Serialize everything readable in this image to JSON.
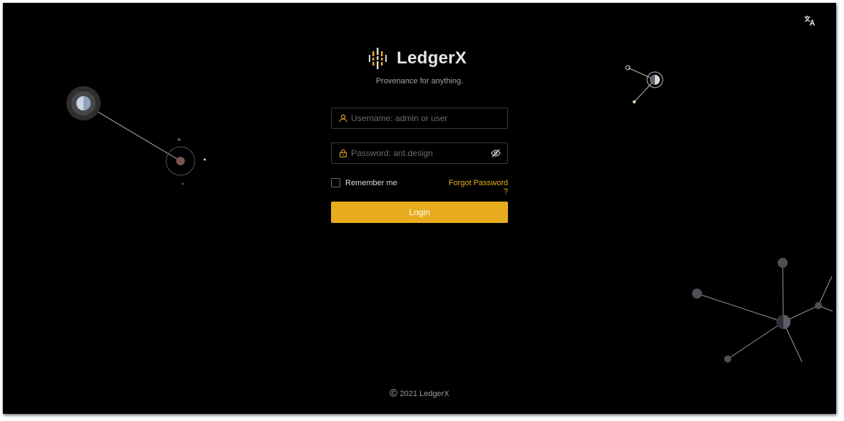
{
  "app": {
    "title": "LedgerX",
    "tagline": "Provenance for anything."
  },
  "header": {
    "language_icon": "translate-icon"
  },
  "login_form": {
    "username": {
      "placeholder": "Username: admin or user",
      "value": "",
      "icon": "user-icon"
    },
    "password": {
      "placeholder": "Password: ant.design",
      "value": "",
      "icon": "lock-icon",
      "toggle_icon": "eye-invisible-icon"
    },
    "remember_label": "Remember me",
    "remember_checked": false,
    "forgot_label": "Forgot Password ?",
    "submit_label": "Login"
  },
  "footer": {
    "text": "2021 LedgerX",
    "icon": "copyright-icon"
  },
  "colors": {
    "background": "#000000",
    "accent": "#e8ac1f",
    "text": "#e6e6e6",
    "muted": "#a3a3a3"
  }
}
